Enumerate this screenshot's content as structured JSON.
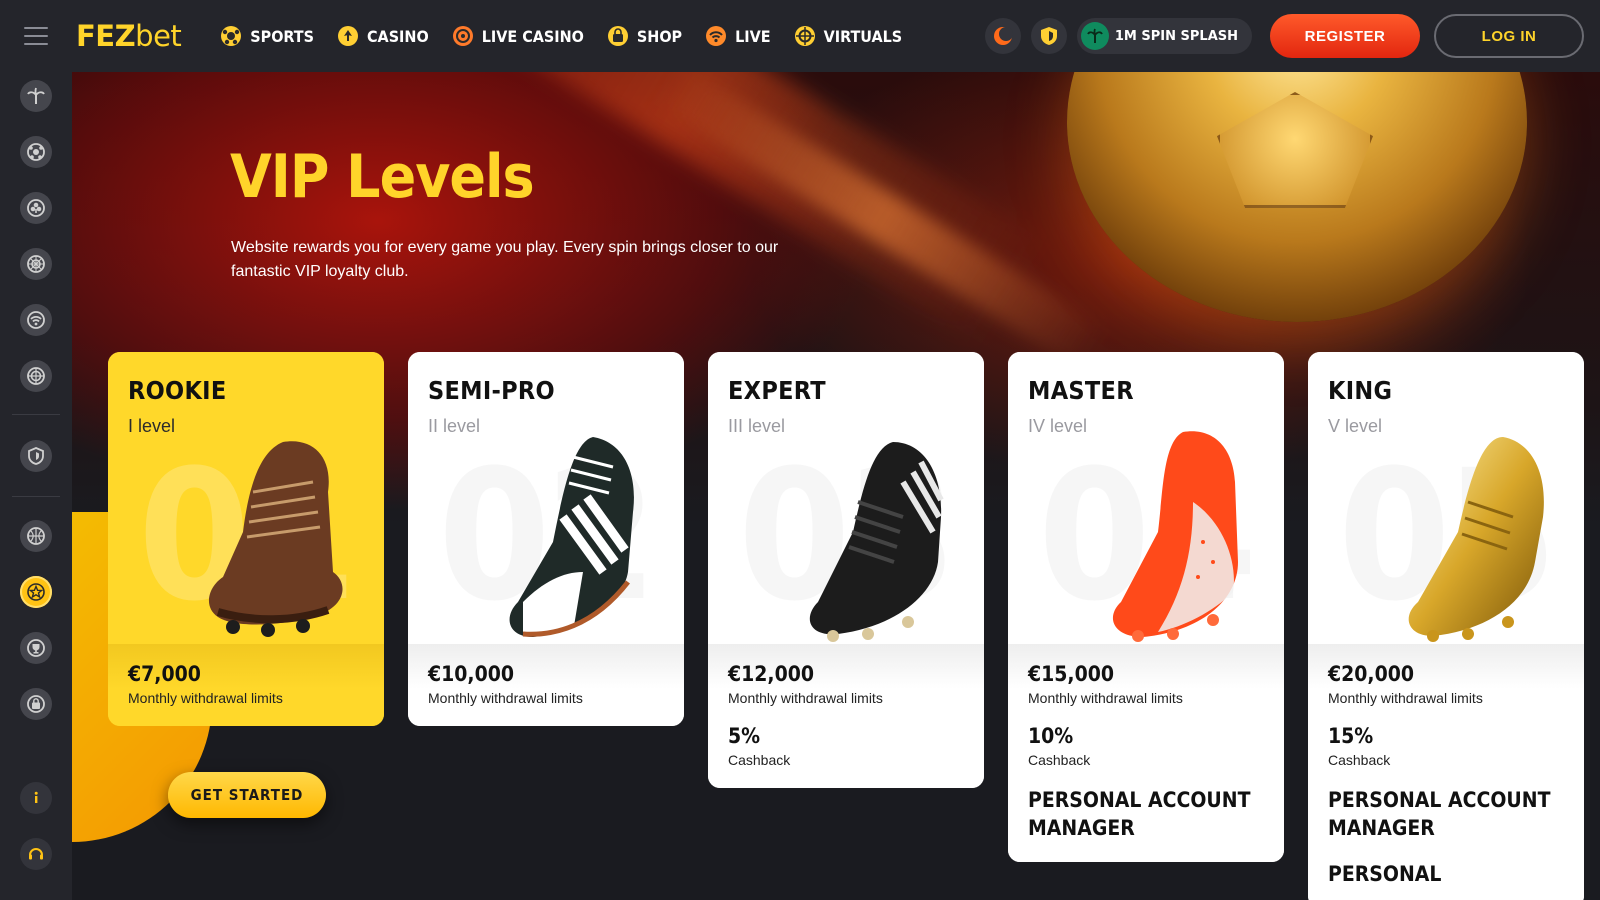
{
  "header": {
    "menu_icon": "hamburger-icon",
    "logo": {
      "part1": "FEZ",
      "part2": "bet"
    },
    "nav": [
      {
        "label": "SPORTS",
        "icon": "soccer-ball-icon"
      },
      {
        "label": "CASINO",
        "icon": "spade-chip-icon"
      },
      {
        "label": "LIVE CASINO",
        "icon": "roulette-icon"
      },
      {
        "label": "SHOP",
        "icon": "shopping-bag-icon"
      },
      {
        "label": "LIVE",
        "icon": "live-signal-icon"
      },
      {
        "label": "VIRTUALS",
        "icon": "virtual-globe-icon"
      }
    ],
    "promo_label": "1M SPIN SPLASH",
    "register_label": "REGISTER",
    "login_label": "LOG IN"
  },
  "sidebar": {
    "items": [
      "palm-tree-icon",
      "soccer-ball-icon",
      "clubs-icon",
      "roulette-icon",
      "live-signal-icon",
      "virtual-globe-icon",
      "shield-icon",
      "basketball-icon",
      "vip-star-icon",
      "trophy-icon",
      "shopping-bag-icon",
      "info-icon",
      "headset-icon"
    ],
    "active": "vip-star-icon"
  },
  "hero": {
    "title": "VIP Levels",
    "description": "Website rewards you for every game you play. Every spin brings closer to our fantastic VIP loyalty club."
  },
  "levels": [
    {
      "name": "ROOKIE",
      "sub": "I level",
      "num": "01",
      "amount": "€7,000",
      "amount_label": "Monthly withdrawal limits"
    },
    {
      "name": "SEMI-PRO",
      "sub": "II level",
      "num": "02",
      "amount": "€10,000",
      "amount_label": "Monthly withdrawal limits"
    },
    {
      "name": "EXPERT",
      "sub": "III level",
      "num": "03",
      "amount": "€12,000",
      "amount_label": "Monthly withdrawal limits",
      "cashback": "5%",
      "cashback_label": "Cashback"
    },
    {
      "name": "MASTER",
      "sub": "IV level",
      "num": "04",
      "amount": "€15,000",
      "amount_label": "Monthly withdrawal limits",
      "cashback": "10%",
      "cashback_label": "Cashback",
      "perk": "PERSONAL ACCOUNT MANAGER"
    },
    {
      "name": "KING",
      "sub": "V level",
      "num": "05",
      "amount": "€20,000",
      "amount_label": "Monthly withdrawal limits",
      "cashback": "15%",
      "cashback_label": "Cashback",
      "perk": "PERSONAL ACCOUNT MANAGER",
      "perk2": "PERSONAL"
    }
  ],
  "cta": {
    "label": "GET STARTED"
  },
  "colors": {
    "accent": "#ffd42a",
    "register": "#f0431a",
    "sidebar": "#24252b"
  }
}
